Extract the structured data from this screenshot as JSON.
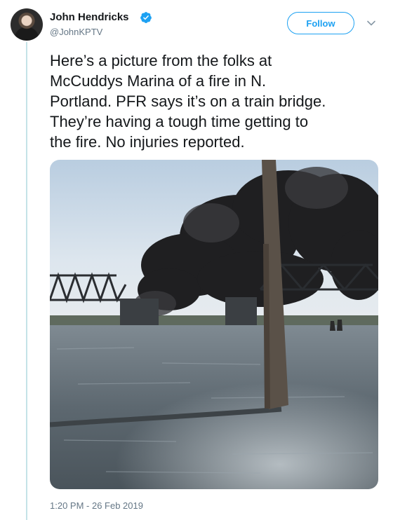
{
  "user": {
    "name": "John Hendricks",
    "handle": "@JohnKPTV",
    "verified_icon": "verified-badge-icon"
  },
  "header": {
    "follow_label": "Follow",
    "menu_icon": "chevron-down-icon"
  },
  "tweet": {
    "text": "Here’s a picture from the folks at\nMcCuddys Marina of a fire in N.\nPortland. PFR says it’s on a train bridge.\nThey’re having a tough time getting to\nthe fire. No injuries reported.",
    "timestamp": "1:20 PM - 26 Feb 2019"
  },
  "colors": {
    "accent": "#1da1f2",
    "text": "#14171a",
    "secondary_text": "#657786",
    "thread_line": "#c5e3e8"
  }
}
